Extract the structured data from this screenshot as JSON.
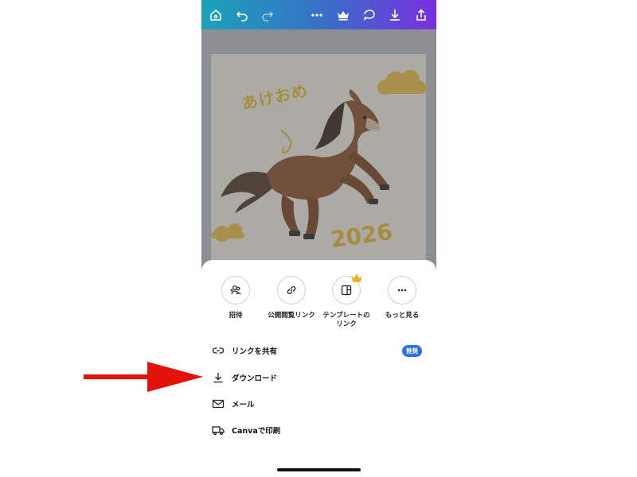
{
  "design": {
    "greeting": "あけおめ",
    "year": "2026"
  },
  "share_actions": [
    {
      "label": "招待",
      "icon": "invite-people-icon"
    },
    {
      "label": "公開閲覧リンク",
      "icon": "link-icon"
    },
    {
      "label": "テンプレートの\nリンク",
      "icon": "template-icon"
    },
    {
      "label": "もっと見る",
      "icon": "more-icon"
    }
  ],
  "menu_rows": [
    {
      "label": "リンクを共有",
      "icon": "link-icon",
      "badge": "推奨"
    },
    {
      "label": "ダウンロード",
      "icon": "download-icon"
    },
    {
      "label": "メール",
      "icon": "mail-icon"
    },
    {
      "label": "Canvaで印刷",
      "icon": "truck-icon"
    }
  ],
  "colors": {
    "toolbar_gradient": [
      "#1aa3b8",
      "#7b2ee0"
    ],
    "badge": "#2b6ef2",
    "annotation_arrow": "#e3120b"
  }
}
